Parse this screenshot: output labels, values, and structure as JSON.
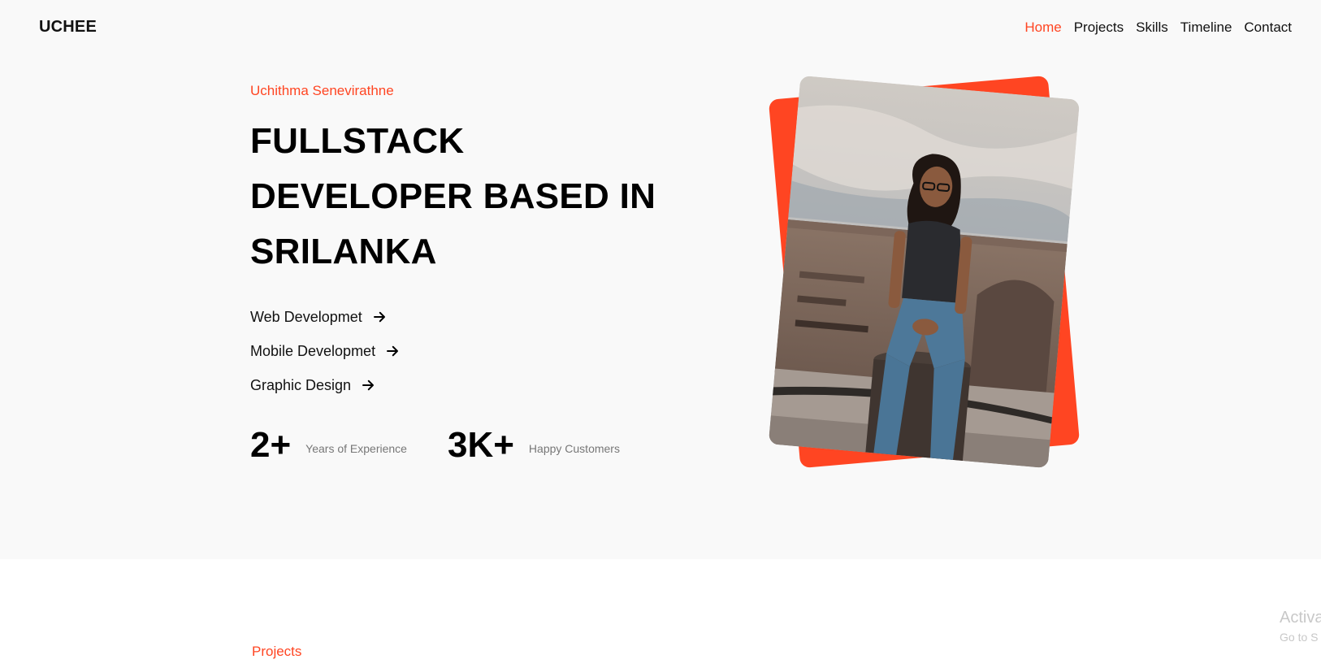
{
  "header": {
    "logo": "UCHEE",
    "nav": [
      {
        "label": "Home",
        "active": true
      },
      {
        "label": "Projects",
        "active": false
      },
      {
        "label": "Skills",
        "active": false
      },
      {
        "label": "Timeline",
        "active": false
      },
      {
        "label": "Contact",
        "active": false
      }
    ]
  },
  "hero": {
    "name": "Uchithma Senevirathne",
    "headline": [
      "FULLSTACK",
      "DEVELOPER BASED IN",
      "SRILANKA"
    ],
    "services": [
      {
        "label": "Web Developmet",
        "icon": "arrow-right-icon"
      },
      {
        "label": "Mobile Developmet",
        "icon": "arrow-right-icon"
      },
      {
        "label": "Graphic Design",
        "icon": "arrow-right-icon"
      }
    ],
    "stats": [
      {
        "value": "2+",
        "label": "Years of Experience"
      },
      {
        "value": "3K+",
        "label": "Happy Customers"
      }
    ]
  },
  "projects": {
    "label": "Projects"
  },
  "watermark": {
    "line1": "Activa",
    "line2": "Go to S"
  },
  "colors": {
    "accent": "#ff4522",
    "hero_background": "#f9f9f9",
    "text": "#111111",
    "muted": "#777777"
  }
}
